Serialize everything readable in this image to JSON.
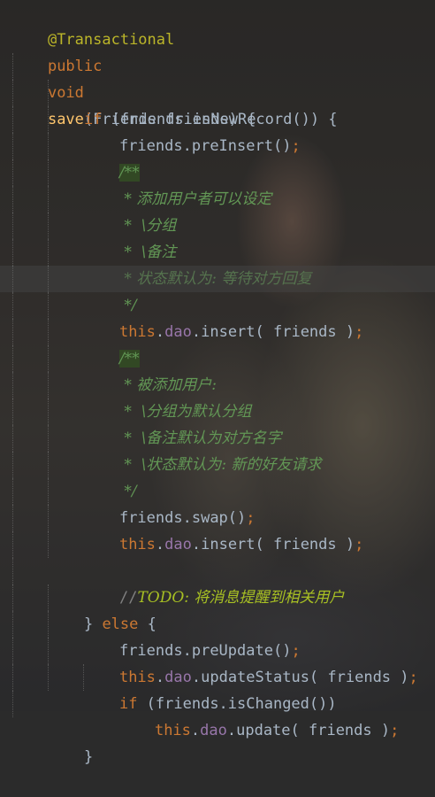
{
  "code": {
    "annotation": "@Transactional",
    "method_sig": {
      "kw_public": "public",
      "kw_void": "void",
      "name": "save",
      "params": "(Friends friends) {"
    },
    "if_new": {
      "kw": "if",
      "rest": " (friends.isNewRecord()) {"
    },
    "pre_insert": {
      "obj": "friends.",
      "method": "preInsert",
      "rest": "()",
      "semi": ";"
    },
    "comment1": [
      "/**",
      " * 添加用户者可以设定",
      " *  \\分组",
      " *  \\备注",
      " * 状态默认为: 等待对方回复",
      " */"
    ],
    "insert1": {
      "this": "this",
      "dot": ".",
      "dao": "dao",
      "call": ".insert( friends )",
      "semi": ";"
    },
    "comment2": [
      "/**",
      " * 被添加用户:",
      " *  \\分组为默认分组",
      " *  \\备注默认为对方名字",
      " *  \\状态默认为: 新的好友请求",
      " */"
    ],
    "swap": {
      "obj": "friends.",
      "method": "swap",
      "rest": "()",
      "semi": ";"
    },
    "insert2": {
      "this": "this",
      "dot": ".",
      "dao": "dao",
      "call": ".insert( friends )",
      "semi": ";"
    },
    "todo": {
      "slashes": "//",
      "text": "TODO: 将消息提醒到相关用户"
    },
    "else_line": {
      "brace": "} ",
      "kw": "else",
      "rest": " {"
    },
    "pre_update": {
      "obj": "friends.",
      "method": "preUpdate",
      "rest": "()",
      "semi": ";"
    },
    "update_status": {
      "this": "this",
      "dot": ".",
      "dao": "dao",
      "call": ".updateStatus( friends )",
      "semi": ";"
    },
    "if_changed": {
      "kw": "if",
      "rest": " (friends.isChanged())"
    },
    "update": {
      "this": "this",
      "dot": ".",
      "dao": "dao",
      "call": ".update( friends )",
      "semi": ";"
    },
    "close_brace": "}"
  }
}
